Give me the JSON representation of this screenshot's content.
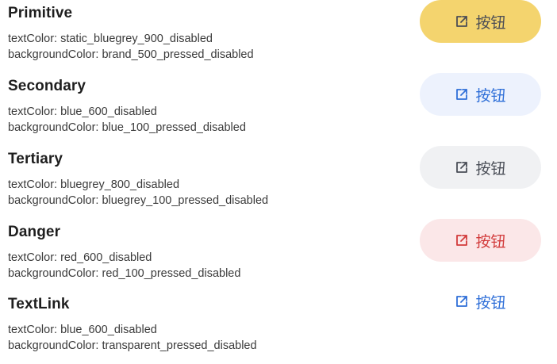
{
  "button_label": "按钮",
  "button_icon": "external-link-icon",
  "variants": [
    {
      "title": "Primitive",
      "text_color_line": "textColor: static_bluegrey_900_disabled",
      "bg_color_line": "backgroundColor: brand_500_pressed_disabled",
      "button_bg": "#f4d46e",
      "button_fg": "#4b4d55"
    },
    {
      "title": "Secondary",
      "text_color_line": "textColor: blue_600_disabled",
      "bg_color_line": "backgroundColor: blue_100_pressed_disabled",
      "button_bg": "#edf2fd",
      "button_fg": "#2f6fd8"
    },
    {
      "title": "Tertiary",
      "text_color_line": "textColor: bluegrey_800_disabled",
      "bg_color_line": "backgroundColor: bluegrey_100_pressed_disabled",
      "button_bg": "#f0f1f3",
      "button_fg": "#4a4e57"
    },
    {
      "title": "Danger",
      "text_color_line": "textColor: red_600_disabled",
      "bg_color_line": "backgroundColor: red_100_pressed_disabled",
      "button_bg": "#fbe7e8",
      "button_fg": "#d23b3b"
    },
    {
      "title": "TextLink",
      "text_color_line": "textColor: blue_600_disabled",
      "bg_color_line": "backgroundColor: transparent_pressed_disabled",
      "button_bg": "transparent",
      "button_fg": "#2f6fd8"
    }
  ]
}
